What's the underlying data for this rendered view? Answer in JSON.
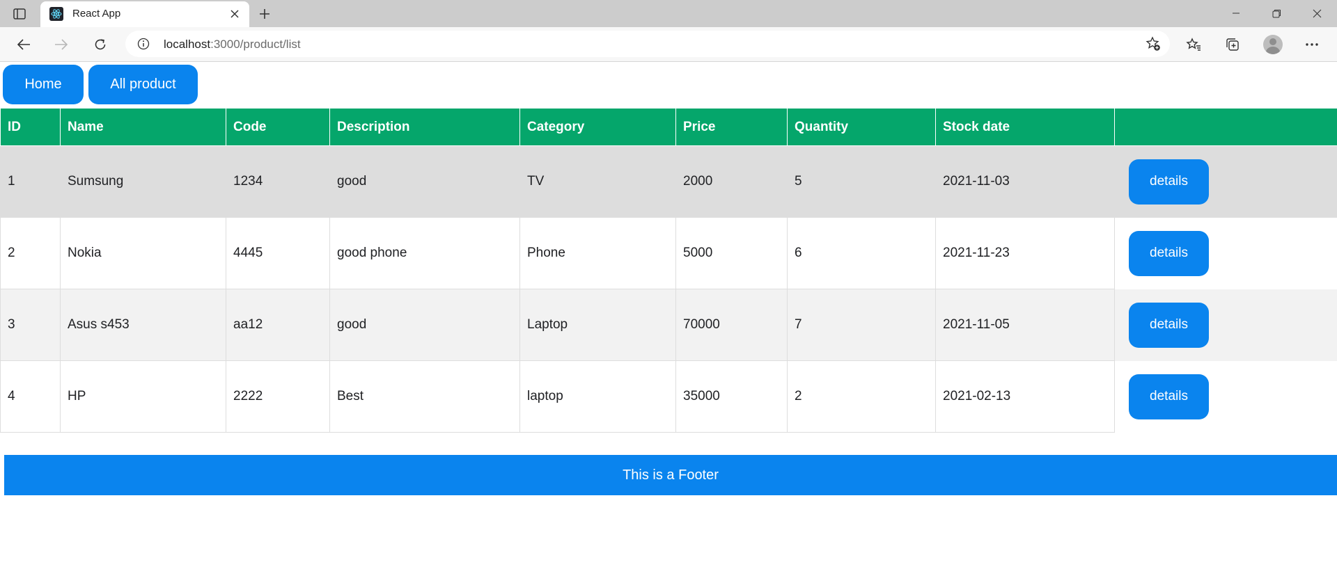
{
  "browser": {
    "tab_title": "React App",
    "url_host": "localhost",
    "url_path": ":3000/product/list"
  },
  "nav": {
    "home_label": "Home",
    "all_product_label": "All product"
  },
  "table": {
    "headers": [
      "ID",
      "Name",
      "Code",
      "Description",
      "Category",
      "Price",
      "Quantity",
      "Stock date",
      ""
    ],
    "rows": [
      {
        "id": "1",
        "name": "Sumsung",
        "code": "1234",
        "description": "good",
        "category": "TV",
        "price": "2000",
        "quantity": "5",
        "stock_date": "2021-11-03",
        "action": "details"
      },
      {
        "id": "2",
        "name": "Nokia",
        "code": "4445",
        "description": "good phone",
        "category": "Phone",
        "price": "5000",
        "quantity": "6",
        "stock_date": "2021-11-23",
        "action": "details"
      },
      {
        "id": "3",
        "name": "Asus s453",
        "code": "aa12",
        "description": "good",
        "category": "Laptop",
        "price": "70000",
        "quantity": "7",
        "stock_date": "2021-11-05",
        "action": "details"
      },
      {
        "id": "4",
        "name": "HP",
        "code": "2222",
        "description": "Best",
        "category": "laptop",
        "price": "35000",
        "quantity": "2",
        "stock_date": "2021-02-13",
        "action": "details"
      }
    ]
  },
  "footer": {
    "text": "This is a Footer"
  },
  "colors": {
    "header_green": "#05a66b",
    "button_blue": "#0a84ee"
  },
  "icons": {
    "tab_actions": "tab-actions-icon",
    "favicon": "react-logo-icon",
    "close": "close-icon",
    "new_tab": "plus-icon",
    "back": "back-arrow-icon",
    "forward": "forward-arrow-icon",
    "refresh": "refresh-icon",
    "site_info": "info-icon",
    "add_favorite": "star-add-icon",
    "favorites": "favorites-icon",
    "collections": "collections-icon",
    "profile": "profile-avatar-icon",
    "menu": "more-icon"
  }
}
